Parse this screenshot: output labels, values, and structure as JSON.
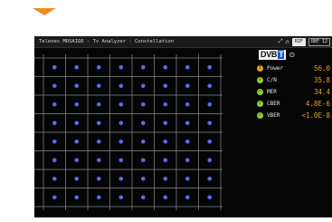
{
  "window": {
    "title": "Telenes MOSAIQ6 - Tv Analyzer - Constellation",
    "status_tags": [
      "RIF",
      "RBF 12"
    ]
  },
  "standard": {
    "logo_main": "DVB",
    "logo_accent": "T"
  },
  "measurements": [
    {
      "label": "Power",
      "value": "56.0",
      "status": "warning",
      "status_color": "#f0a020"
    },
    {
      "label": "C/N",
      "value": "35.8",
      "status": "ok",
      "status_color": "#8fd12a"
    },
    {
      "label": "MER",
      "value": "34.4",
      "status": "ok",
      "status_color": "#8fd12a"
    },
    {
      "label": "CBER",
      "value": "4.8E-6",
      "status": "ok",
      "status_color": "#8fd12a"
    },
    {
      "label": "VBER",
      "value": "<1.0E-8",
      "status": "ok",
      "status_color": "#8fd12a"
    }
  ],
  "constellation": {
    "order": 64,
    "grid_lines": 8,
    "point_color": "#5a6cf0",
    "grid_color": "#8a8a8a"
  },
  "colors": {
    "accent": "#f08d1e",
    "background": "#050505",
    "value": "#f0a020"
  }
}
